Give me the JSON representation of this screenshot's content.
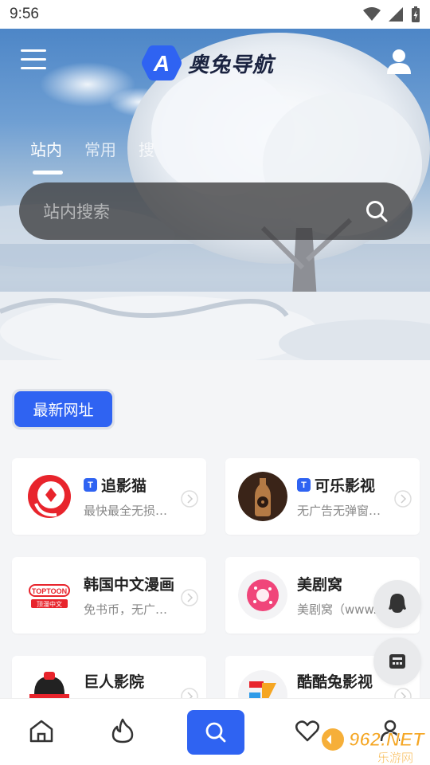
{
  "status_bar": {
    "time": "9:56"
  },
  "header": {
    "app_title": "奥兔导航",
    "logo_letter": "A"
  },
  "tabs": [
    {
      "label": "站内",
      "active": true
    },
    {
      "label": "常用",
      "active": false
    },
    {
      "label": "搜",
      "active": false
    }
  ],
  "search": {
    "placeholder": "站内搜索"
  },
  "section": {
    "label": "最新网址"
  },
  "cards": [
    {
      "title": "追影猫",
      "badge": "T",
      "desc": "最快最全无损…",
      "icon": "zhuiyingmao-logo"
    },
    {
      "title": "可乐影视",
      "badge": "T",
      "desc": "无广告无弹窗…",
      "icon": "cola-bottle-logo"
    },
    {
      "title": "韩国中文漫画",
      "badge": "",
      "desc": "免书币，无广…",
      "icon": "toptoon-logo",
      "icon_text_top": "TOPTOON",
      "icon_text_bottom": "顶漫中文"
    },
    {
      "title": "美剧窝",
      "badge": "",
      "desc": "美剧窝（www.…",
      "icon": "meijuwo-logo"
    },
    {
      "title": "巨人影院",
      "badge": "",
      "desc": "",
      "icon": "juren-logo"
    },
    {
      "title": "酷酷兔影视",
      "badge": "",
      "desc": "",
      "icon": "kukutu-logo"
    }
  ],
  "floating": [
    {
      "icon": "qq-penguin-icon"
    },
    {
      "icon": "calculator-icon"
    }
  ],
  "bottom_nav": [
    {
      "icon": "home-icon"
    },
    {
      "icon": "fire-icon"
    },
    {
      "icon": "search-icon",
      "active": true
    },
    {
      "icon": "heart-icon"
    },
    {
      "icon": "user-icon"
    }
  ],
  "watermark": {
    "brand": "962.NET",
    "sub": "乐游网"
  },
  "colors": {
    "accent": "#2f63f2",
    "card_bg": "#ffffff",
    "page_bg": "#f4f5f7"
  }
}
